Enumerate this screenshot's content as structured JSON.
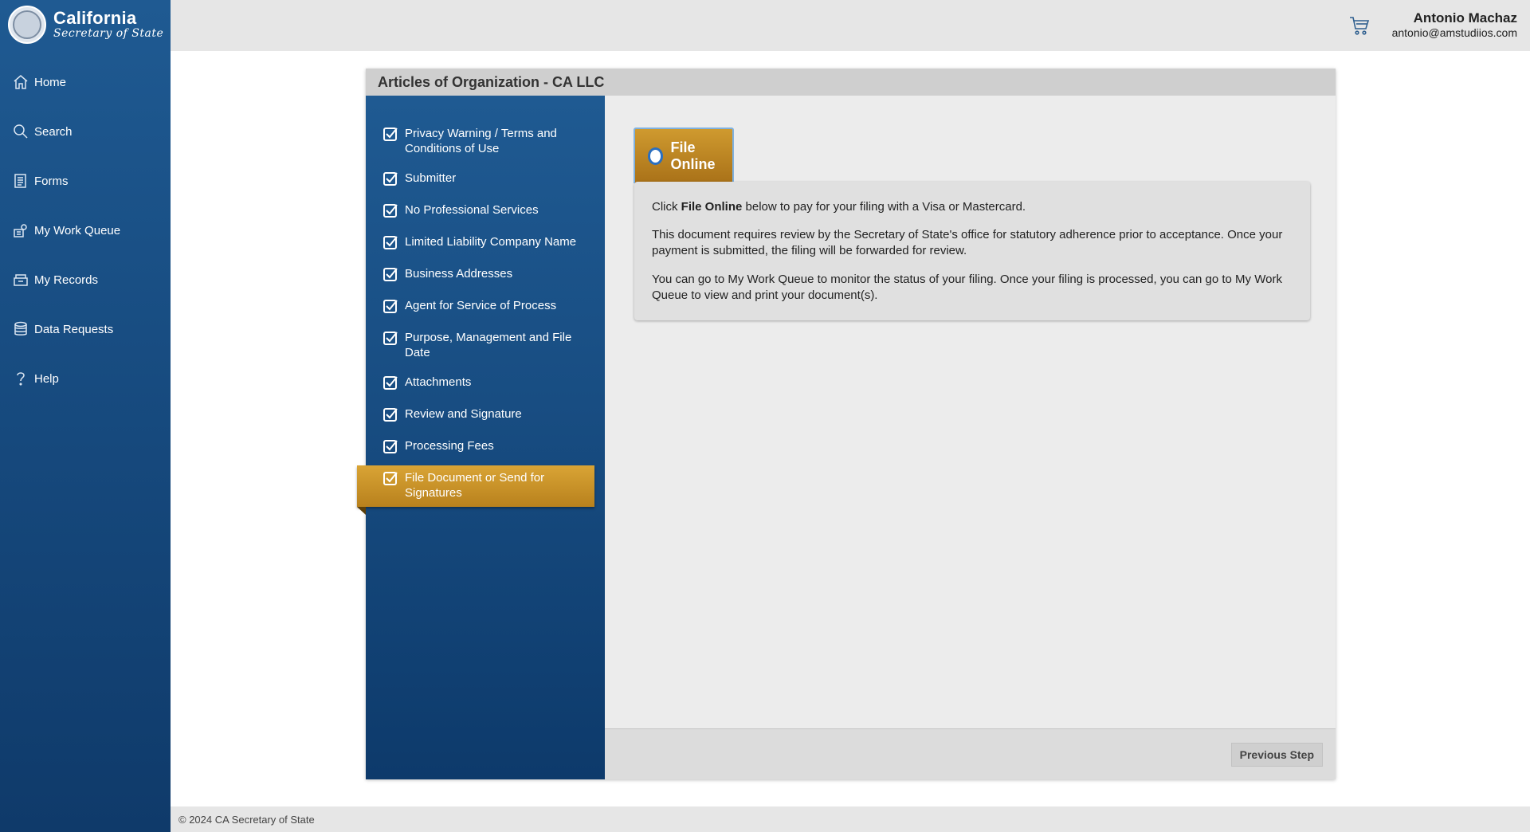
{
  "brand": {
    "title": "California",
    "subtitle": "Secretary of State",
    "logo_icon": "state-seal"
  },
  "nav": [
    {
      "label": "Home",
      "icon": "home-icon"
    },
    {
      "label": "Search",
      "icon": "search-icon"
    },
    {
      "label": "Forms",
      "icon": "forms-icon"
    },
    {
      "label": "My Work Queue",
      "icon": "work-queue-icon"
    },
    {
      "label": "My Records",
      "icon": "records-icon"
    },
    {
      "label": "Data Requests",
      "icon": "database-icon"
    },
    {
      "label": "Help",
      "icon": "help-icon"
    }
  ],
  "header": {
    "cart_icon": "cart-icon",
    "user_name": "Antonio Machaz",
    "user_email": "antonio@amstudiios.com"
  },
  "panel": {
    "title": "Articles of Organization - CA LLC"
  },
  "steps": [
    {
      "label": "Privacy Warning / Terms and Conditions of Use"
    },
    {
      "label": "Submitter"
    },
    {
      "label": "No Professional Services"
    },
    {
      "label": "Limited Liability Company Name"
    },
    {
      "label": "Business Addresses"
    },
    {
      "label": "Agent for Service of Process"
    },
    {
      "label": "Purpose, Management and File Date"
    },
    {
      "label": "Attachments"
    },
    {
      "label": "Review and Signature"
    },
    {
      "label": "Processing Fees"
    },
    {
      "label": "File Document or Send for Signatures",
      "active": true
    }
  ],
  "file_online": {
    "tab_label": "File Online",
    "para1_prefix": "Click ",
    "para1_bold": "File Online",
    "para1_suffix": " below to pay for your filing with a Visa or Mastercard.",
    "para2": "This document requires review by the Secretary of State's office for statutory adherence prior to acceptance. Once your payment is submitted, the filing will be forwarded for review.",
    "para3": "You can go to My Work Queue to monitor the status of your filing. Once your filing is processed, you can go to My Work Queue to view and print your document(s)."
  },
  "actions": {
    "previous_label": "Previous Step"
  },
  "footer": {
    "copyright": "© 2024 CA Secretary of State"
  },
  "colors": {
    "sidebar_blue": "#1f5a92",
    "active_gold": "#cf9a2f",
    "radio_blue": "#2a6fc0"
  }
}
